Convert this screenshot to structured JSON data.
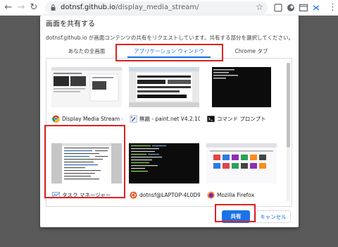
{
  "browser": {
    "domain": "dotnsf.github.io",
    "path": "/display_media_stream/"
  },
  "dialog": {
    "title": "画面を共有する",
    "description": "dotnsf.github.io が画面コンテンツの共有をリクエストしています。共有する部分を選択してください。",
    "tabs": [
      {
        "label": "あなたの全画面",
        "active": false
      },
      {
        "label": "アプリケーション ウィンドウ",
        "active": true
      },
      {
        "label": "Chrome タブ",
        "active": false
      }
    ],
    "sources": [
      {
        "name": "Display Media Stream - ...",
        "icon": "chrome-icon",
        "selected": false
      },
      {
        "name": "無題 - paint.net V4.2.10",
        "icon": "paintnet-icon",
        "selected": false
      },
      {
        "name": "コマンド プロンプト",
        "icon": "terminal-icon",
        "selected": false
      },
      {
        "name": "タスク マネージャー",
        "icon": "task-manager-icon",
        "selected": true
      },
      {
        "name": "dotnsf@LAPTOP-4L0D9...",
        "icon": "ubuntu-icon",
        "selected": false
      },
      {
        "name": "Mozilla Firefox",
        "icon": "firefox-icon",
        "selected": false
      }
    ],
    "buttons": {
      "share": "共有",
      "cancel": "キャンセル"
    }
  },
  "colors": {
    "accent": "#1a73e8",
    "highlight": "#e02020"
  }
}
